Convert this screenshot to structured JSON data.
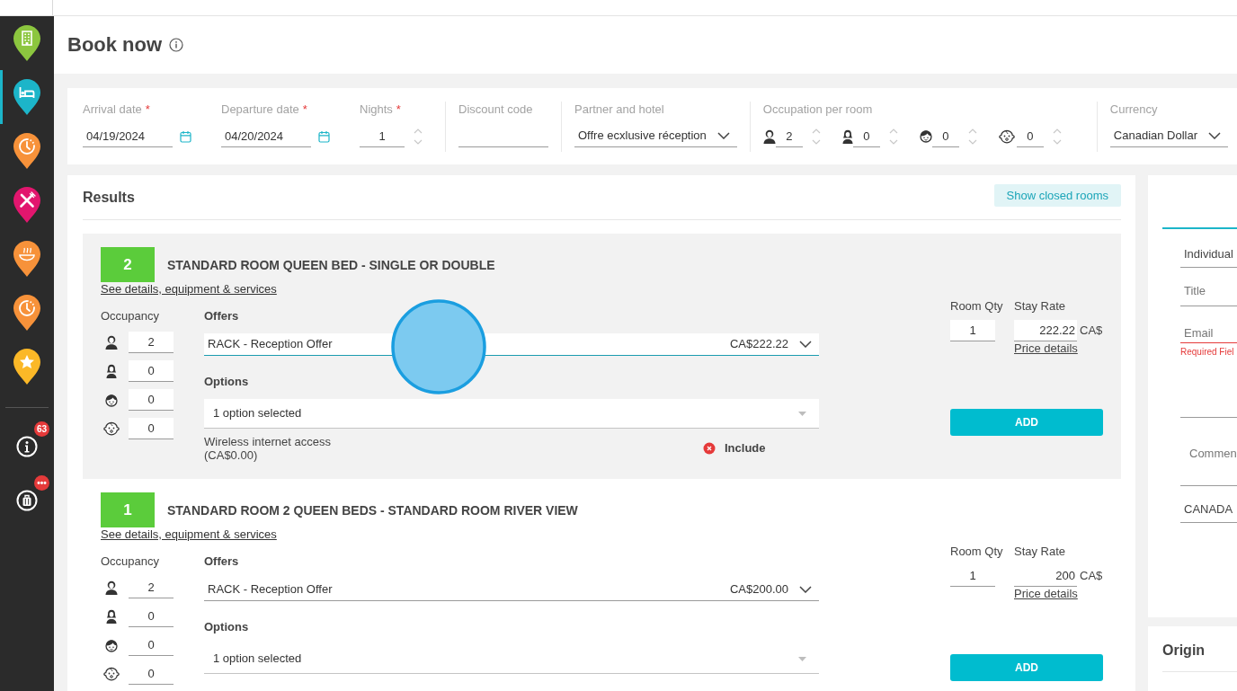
{
  "sidebar": {
    "items": [
      {
        "kind": "building",
        "color": "#8cc63f",
        "selected": false
      },
      {
        "kind": "bed",
        "color": "#1cb5c9",
        "selected": true
      },
      {
        "kind": "clock",
        "color": "#f7923a",
        "selected": false
      },
      {
        "kind": "dining",
        "color": "#e2166e",
        "selected": false
      },
      {
        "kind": "dish",
        "color": "#f7923a",
        "selected": false
      },
      {
        "kind": "clock",
        "color": "#f7923a",
        "selected": false
      },
      {
        "kind": "star",
        "color": "#fbb827",
        "selected": false
      }
    ],
    "tools": [
      {
        "kind": "info",
        "badge": "63"
      },
      {
        "kind": "luggage",
        "badge": "•••"
      }
    ]
  },
  "page": {
    "title": "Book now"
  },
  "search": {
    "fields": [
      {
        "kind": "date",
        "label": "Arrival date",
        "required_mark": "*",
        "value": "04/19/2024"
      },
      {
        "kind": "date",
        "label": "Departure date",
        "required_mark": "*",
        "value": "04/20/2024"
      },
      {
        "kind": "number",
        "label": "Nights",
        "required_mark": "*",
        "value": "1"
      },
      {
        "kind": "text",
        "label": "Discount code"
      },
      {
        "kind": "select",
        "label": "Partner and hotel",
        "value": "Offre ecxlusive réception"
      },
      {
        "kind": "occupation",
        "label": "Occupation per room",
        "guests": [
          {
            "kind": "man",
            "value": "2"
          },
          {
            "kind": "woman",
            "value": "0"
          },
          {
            "kind": "child",
            "value": "0"
          },
          {
            "kind": "baby",
            "value": "0"
          }
        ]
      },
      {
        "kind": "select",
        "label": "Currency",
        "value": "Canadian Dollar"
      }
    ]
  },
  "results": {
    "title": "Results",
    "closed_rooms_button": "Show closed rooms",
    "rooms": [
      {
        "active": true,
        "tap_indicator": true,
        "available": "2",
        "name": "STANDARD ROOM QUEEN BED - SINGLE OR DOUBLE",
        "details_link": "See details, equipment & services",
        "occupancy_label": "Occupancy",
        "occupancy": [
          {
            "kind": "man",
            "value": "2"
          },
          {
            "kind": "woman",
            "value": "0"
          },
          {
            "kind": "child",
            "value": "0"
          },
          {
            "kind": "baby",
            "value": "0"
          }
        ],
        "offers_label": "Offers",
        "offer": {
          "name": "RACK - Reception Offer",
          "price": "CA$222.22"
        },
        "options_label": "Options",
        "options_value": "1 option selected",
        "option_items": [
          {
            "name": "Wireless internet access",
            "price": "(CA$0.00)",
            "included": false,
            "action": "Include"
          }
        ],
        "qty_label": "Room Qty",
        "qty": "1",
        "rate_label": "Stay Rate",
        "rate": "222.22",
        "rate_currency": "CA$",
        "price_details": "Price details",
        "add_button": "ADD"
      },
      {
        "active": false,
        "available": "1",
        "name": "STANDARD ROOM 2 QUEEN BEDS - STANDARD ROOM RIVER VIEW",
        "details_link": "See details, equipment & services",
        "occupancy_label": "Occupancy",
        "occupancy": [
          {
            "kind": "man",
            "value": "2"
          },
          {
            "kind": "woman",
            "value": "0"
          },
          {
            "kind": "child",
            "value": "0"
          },
          {
            "kind": "baby",
            "value": "0"
          }
        ],
        "offers_label": "Offers",
        "offer": {
          "name": "RACK - Reception Offer",
          "price": "CA$200.00"
        },
        "options_label": "Options",
        "options_value": "1 option selected",
        "qty_label": "Room Qty",
        "qty": "1",
        "rate_label": "Stay Rate",
        "rate": "200",
        "rate_currency": "CA$",
        "price_details": "Price details",
        "add_button": "ADD"
      }
    ]
  },
  "guest_panel": {
    "fields": [
      {
        "kind": "select",
        "value": "Individual"
      },
      {
        "kind": "input",
        "placeholder": "Title"
      },
      {
        "kind": "input",
        "placeholder": "Email",
        "error": "Required Fiel"
      },
      {
        "kind": "input"
      },
      {
        "kind": "textarea",
        "placeholder": "Commen"
      },
      {
        "kind": "select",
        "value": "CANADA"
      }
    ]
  },
  "origin_panel": {
    "title": "Origin"
  }
}
